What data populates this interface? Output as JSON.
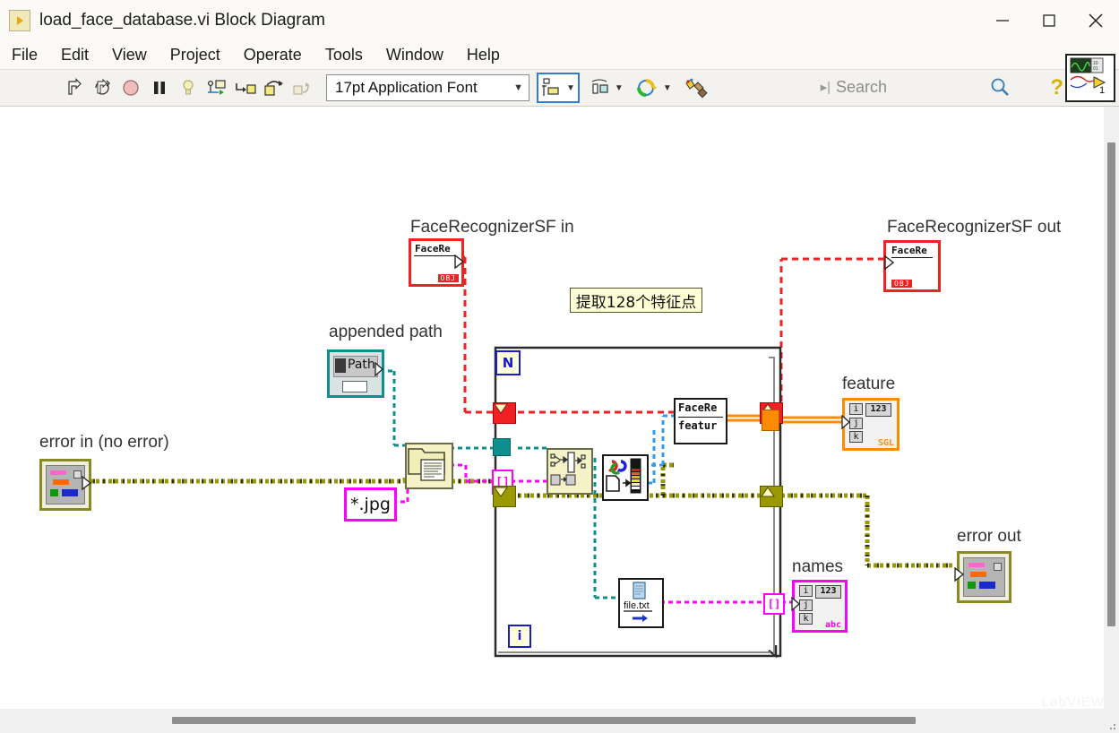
{
  "window": {
    "title": "load_face_database.vi Block Diagram",
    "app_icon": "labview-vi-icon",
    "buttons": [
      {
        "name": "minimize-button",
        "glyph": "minimize-icon"
      },
      {
        "name": "maximize-button",
        "glyph": "maximize-icon"
      },
      {
        "name": "close-button",
        "glyph": "close-icon"
      }
    ]
  },
  "menubar": {
    "items": [
      "File",
      "Edit",
      "View",
      "Project",
      "Operate",
      "Tools",
      "Window",
      "Help"
    ]
  },
  "toolbar": {
    "icons": [
      {
        "name": "run-button",
        "icon": "run-arrow-icon"
      },
      {
        "name": "run-continuously-button",
        "icon": "run-continuous-icon"
      },
      {
        "name": "abort-execution-button",
        "icon": "abort-stop-icon"
      },
      {
        "name": "pause-button",
        "icon": "pause-icon"
      },
      {
        "name": "highlight-execution-button",
        "icon": "lightbulb-icon"
      },
      {
        "name": "retain-wire-values-button",
        "icon": "retain-wire-values-icon"
      },
      {
        "name": "step-into-button",
        "icon": "step-into-icon"
      },
      {
        "name": "step-over-button",
        "icon": "step-over-icon"
      },
      {
        "name": "step-out-button",
        "icon": "step-out-icon"
      }
    ],
    "font_select": {
      "value": "17pt Application Font",
      "chevron": "chevron-down-icon"
    },
    "align_objects": {
      "name": "align-objects-button",
      "icon": "align-objects-icon"
    },
    "distribute_objects": {
      "name": "distribute-objects-button",
      "icon": "distribute-objects-icon"
    },
    "reorder_objects": {
      "name": "reorder-objects-button",
      "icon": "reorder-objects-icon"
    },
    "clean_up_diagram": {
      "name": "clean-up-diagram-button",
      "icon": "clean-up-diagram-icon"
    },
    "search": {
      "placeholder": "Search",
      "value": "",
      "icon": "search-icon"
    },
    "help_button": {
      "name": "help-button",
      "glyph": "?"
    },
    "vi_icon": {
      "name": "vi-icon-pane",
      "badge": "1"
    }
  },
  "diagram": {
    "labels": {
      "face_recognizer_in": "FaceRecognizerSF in",
      "face_recognizer_out": "FaceRecognizerSF out",
      "appended_path": "appended path",
      "error_in": "error in (no error)",
      "error_out": "error out",
      "feature": "feature",
      "names": "names",
      "comment": "提取128个特征点"
    },
    "nodes": {
      "face_recognizer_in_terminal": {
        "caption": "FaceRe",
        "type_tag": "OBJ",
        "color": "#ee2222"
      },
      "face_recognizer_out_terminal": {
        "caption": "FaceRe",
        "type_tag": "OBJ",
        "color": "#ee2222"
      },
      "appended_path_terminal": {
        "caption": "Path",
        "color": "#0d8f8f"
      },
      "jpg_constant": {
        "value": "*.jpg",
        "color": "#ff00ff"
      },
      "feature_indicator": {
        "rows": [
          "i",
          "j",
          "k"
        ],
        "value": "123",
        "type_tag": "SGL",
        "color": "#ff8c00"
      },
      "names_indicator": {
        "rows": [
          "i",
          "j",
          "k"
        ],
        "value": "123",
        "type_tag": "abc",
        "color": "#ff00ff"
      },
      "face_recognizer_feature_node": {
        "line1": "FaceRe",
        "line2": "featur"
      },
      "list_folder_node": {
        "icon": "list-folder-icon"
      },
      "array_subset_node": {
        "icon": "array-index-icon"
      },
      "imread_node": {
        "icon": "imread-color-icon"
      },
      "file_text_node": {
        "label": "file.txt",
        "icon": "write-file-icon"
      },
      "index_array_bracket": {
        "label": "[]"
      }
    },
    "loop": {
      "type": "for-loop",
      "count_terminal": "N",
      "iteration_terminal": "i"
    },
    "colors": {
      "error_wire": "#9a9a00",
      "path_wire": "#0d8f8f",
      "string_wire": "#ff00ff",
      "refnum_wire": "#ee2222",
      "image_wire": "#3399ee",
      "sgl_wire": "#ff8c00",
      "comment_bg": "#ffffd6"
    }
  },
  "scrollbars": {
    "vertical": {
      "name": "vertical-scrollbar"
    },
    "horizontal": {
      "name": "horizontal-scrollbar"
    }
  },
  "watermark": "LabVIEW"
}
